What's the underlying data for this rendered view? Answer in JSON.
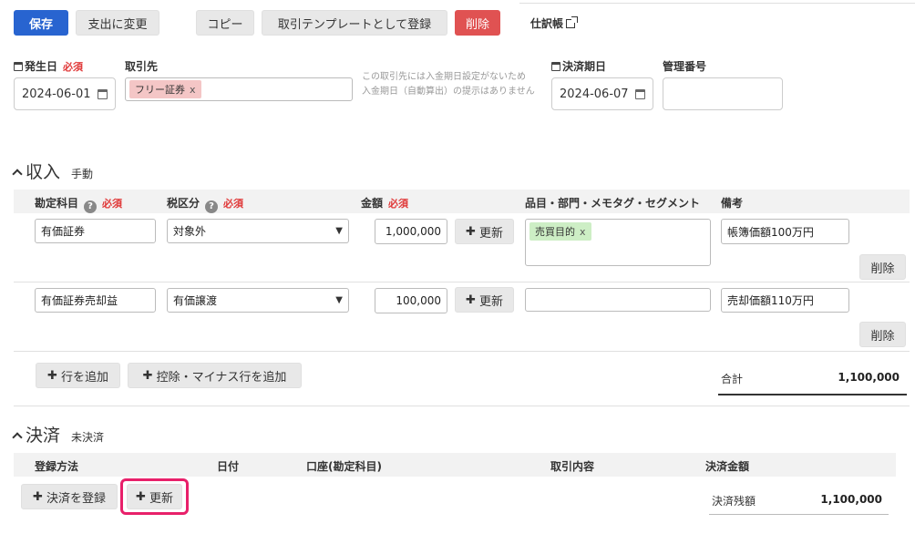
{
  "toolbar": {
    "save": "保存",
    "to_expense": "支出に変更",
    "copy": "コピー",
    "register_template": "取引テンプレートとして登録",
    "delete": "削除",
    "journal": "仕訳帳"
  },
  "header": {
    "issue_date_label": "発生日",
    "required": "必須",
    "issue_date": "2024-06-01",
    "partner_label": "取引先",
    "partner_tag": "フリー証券",
    "tag_remove": "x",
    "partner_note_1": "この取引先には入金期日設定がないため",
    "partner_note_2": "入金期日（自動算出）の提示はありません",
    "due_date_label": "決済期日",
    "due_date": "2024-06-07",
    "mgmt_no_label": "管理番号",
    "mgmt_no": ""
  },
  "income": {
    "title": "収入",
    "mode": "手動",
    "columns": {
      "account": "勘定科目",
      "tax": "税区分",
      "amount": "金額",
      "items": "品目・部門・メモタグ・セグメント",
      "memo": "備考"
    },
    "rows": [
      {
        "account": "有価証券",
        "tax": "対象外",
        "amount": "1,000,000",
        "update": "更新",
        "tag": "売買目的",
        "memo": "帳簿価額100万円",
        "delete": "削除"
      },
      {
        "account": "有価証券売却益",
        "tax": "有価譲渡",
        "amount": "100,000",
        "update": "更新",
        "tag": "",
        "memo": "売却価額110万円",
        "delete": "削除"
      }
    ],
    "add_row": "行を追加",
    "add_deduction_row": "控除・マイナス行を追加",
    "total_label": "合計",
    "total": "1,100,000"
  },
  "settlement": {
    "title": "決済",
    "status": "未決済",
    "columns": {
      "method": "登録方法",
      "date": "日付",
      "account": "口座(勘定科目)",
      "content": "取引内容",
      "amount": "決済金額"
    },
    "register": "決済を登録",
    "update": "更新",
    "balance_label": "決済残額",
    "balance": "1,100,000"
  },
  "colors": {
    "primary": "#2864d0",
    "danger": "#e05252",
    "highlight": "#e8206a"
  }
}
